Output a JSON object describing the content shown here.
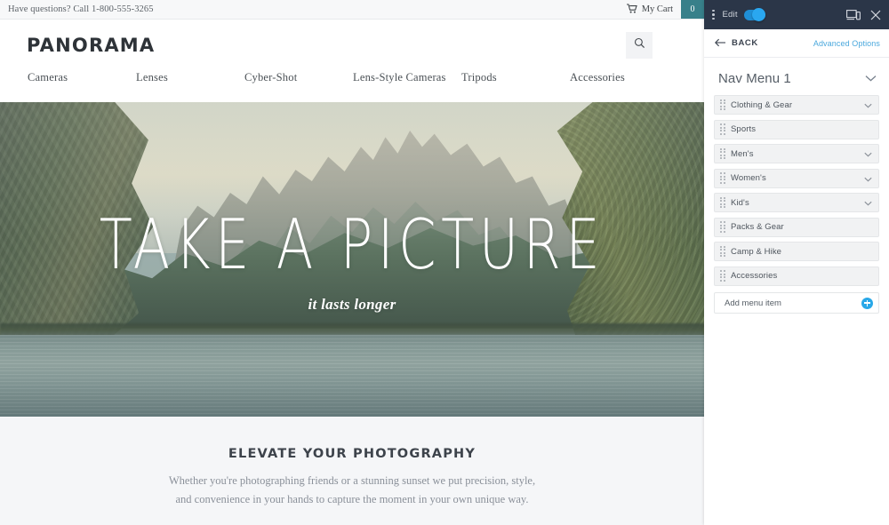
{
  "site": {
    "utility": {
      "phone_text": "Have questions? Call 1-800-555-3265",
      "cart_label": "My Cart",
      "cart_count": "0",
      "cart_badge_color": "#38808a"
    },
    "brand": "PANORAMA",
    "search_icon": "search-icon",
    "nav_items": [
      {
        "label": "Cameras"
      },
      {
        "label": "Lenses"
      },
      {
        "label": "Cyber-Shot"
      },
      {
        "label": "Lens-Style Cameras"
      },
      {
        "label": "Tripods"
      },
      {
        "label": "Accessories"
      }
    ],
    "hero": {
      "title": "TAKE A PICTURE",
      "subtitle": "it lasts longer"
    },
    "section": {
      "title": "ELEVATE YOUR PHOTOGRAPHY",
      "line1": "Whether you're photographing friends or a stunning sunset we put precision, style,",
      "line2": "and convenience in your hands to capture the moment in your own unique way."
    }
  },
  "panel": {
    "topbar": {
      "kebab_icon": "more-vertical-icon",
      "edit_label": "Edit",
      "edit_enabled": true,
      "device_preview_icon": "device-preview-icon",
      "close_icon": "close-icon",
      "background": "#2b3648",
      "toggle_color": "#2aa7f0"
    },
    "subbar": {
      "back_icon": "arrow-left-icon",
      "back_label": "BACK",
      "advanced_label": "Advanced Options",
      "advanced_color": "#4aa8dd"
    },
    "menu": {
      "title": "Nav Menu 1",
      "collapse_icon": "chevron-down-icon",
      "items": [
        {
          "label": "Clothing & Gear",
          "has_chevron": true
        },
        {
          "label": "Sports",
          "has_chevron": false
        },
        {
          "label": "Men's",
          "has_chevron": true
        },
        {
          "label": "Women's",
          "has_chevron": true
        },
        {
          "label": "Kid's",
          "has_chevron": true
        },
        {
          "label": "Packs & Gear",
          "has_chevron": false
        },
        {
          "label": "Camp & Hike",
          "has_chevron": false
        },
        {
          "label": "Accessories",
          "has_chevron": false
        }
      ],
      "add_label": "Add menu item",
      "add_icon": "plus-circle-icon",
      "add_icon_color": "#29a8e8"
    }
  }
}
